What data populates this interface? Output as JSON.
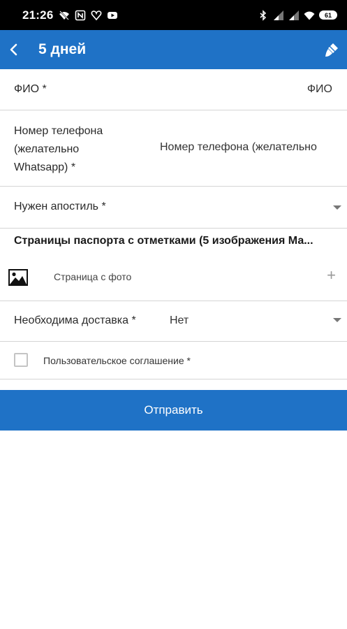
{
  "status_bar": {
    "time": "21:26",
    "battery": "61"
  },
  "app_bar": {
    "title": "5 дней"
  },
  "form": {
    "fio": {
      "label": "ФИО *",
      "placeholder": "ФИО"
    },
    "phone": {
      "label": "Номер телефона (желательно Whatsapp) *",
      "placeholder": "Номер телефона (желательно"
    },
    "apostille": {
      "label": "Нужен апостиль *"
    },
    "passport_section": {
      "title": "Страницы паспорта с отметками (5 изображения Ма..."
    },
    "photo_page": {
      "label": "Страница с фото",
      "add_glyph": "+"
    },
    "delivery": {
      "label": "Необходима доставка *",
      "value": "Нет"
    },
    "agreement": {
      "label": "Пользовательское соглашение *",
      "checked": false
    }
  },
  "submit": {
    "label": "Отправить"
  },
  "colors": {
    "primary": "#1f72c6",
    "status_bar": "#000000",
    "divider": "#d5d5d5"
  }
}
